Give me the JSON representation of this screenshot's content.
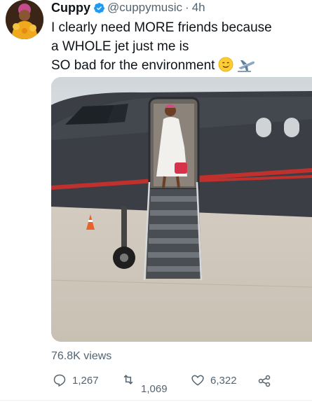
{
  "tweet": {
    "author_name": "Cuppy",
    "handle": "@cuppymusic",
    "separator": "·",
    "time": "4h",
    "text_lines": [
      "I clearly need MORE friends because",
      "a WHOLE jet just me is",
      "SO bad for the environment"
    ],
    "emojis": [
      "smiling-face-with-tear-icon",
      "airplane-departure-icon"
    ],
    "views": "76.8K views",
    "actions": {
      "replies": "1,267",
      "retweets": "1,069",
      "likes": "6,322"
    }
  },
  "colors": {
    "text": "#0f1419",
    "secondary": "#536471",
    "verified": "#1d9bf0"
  }
}
